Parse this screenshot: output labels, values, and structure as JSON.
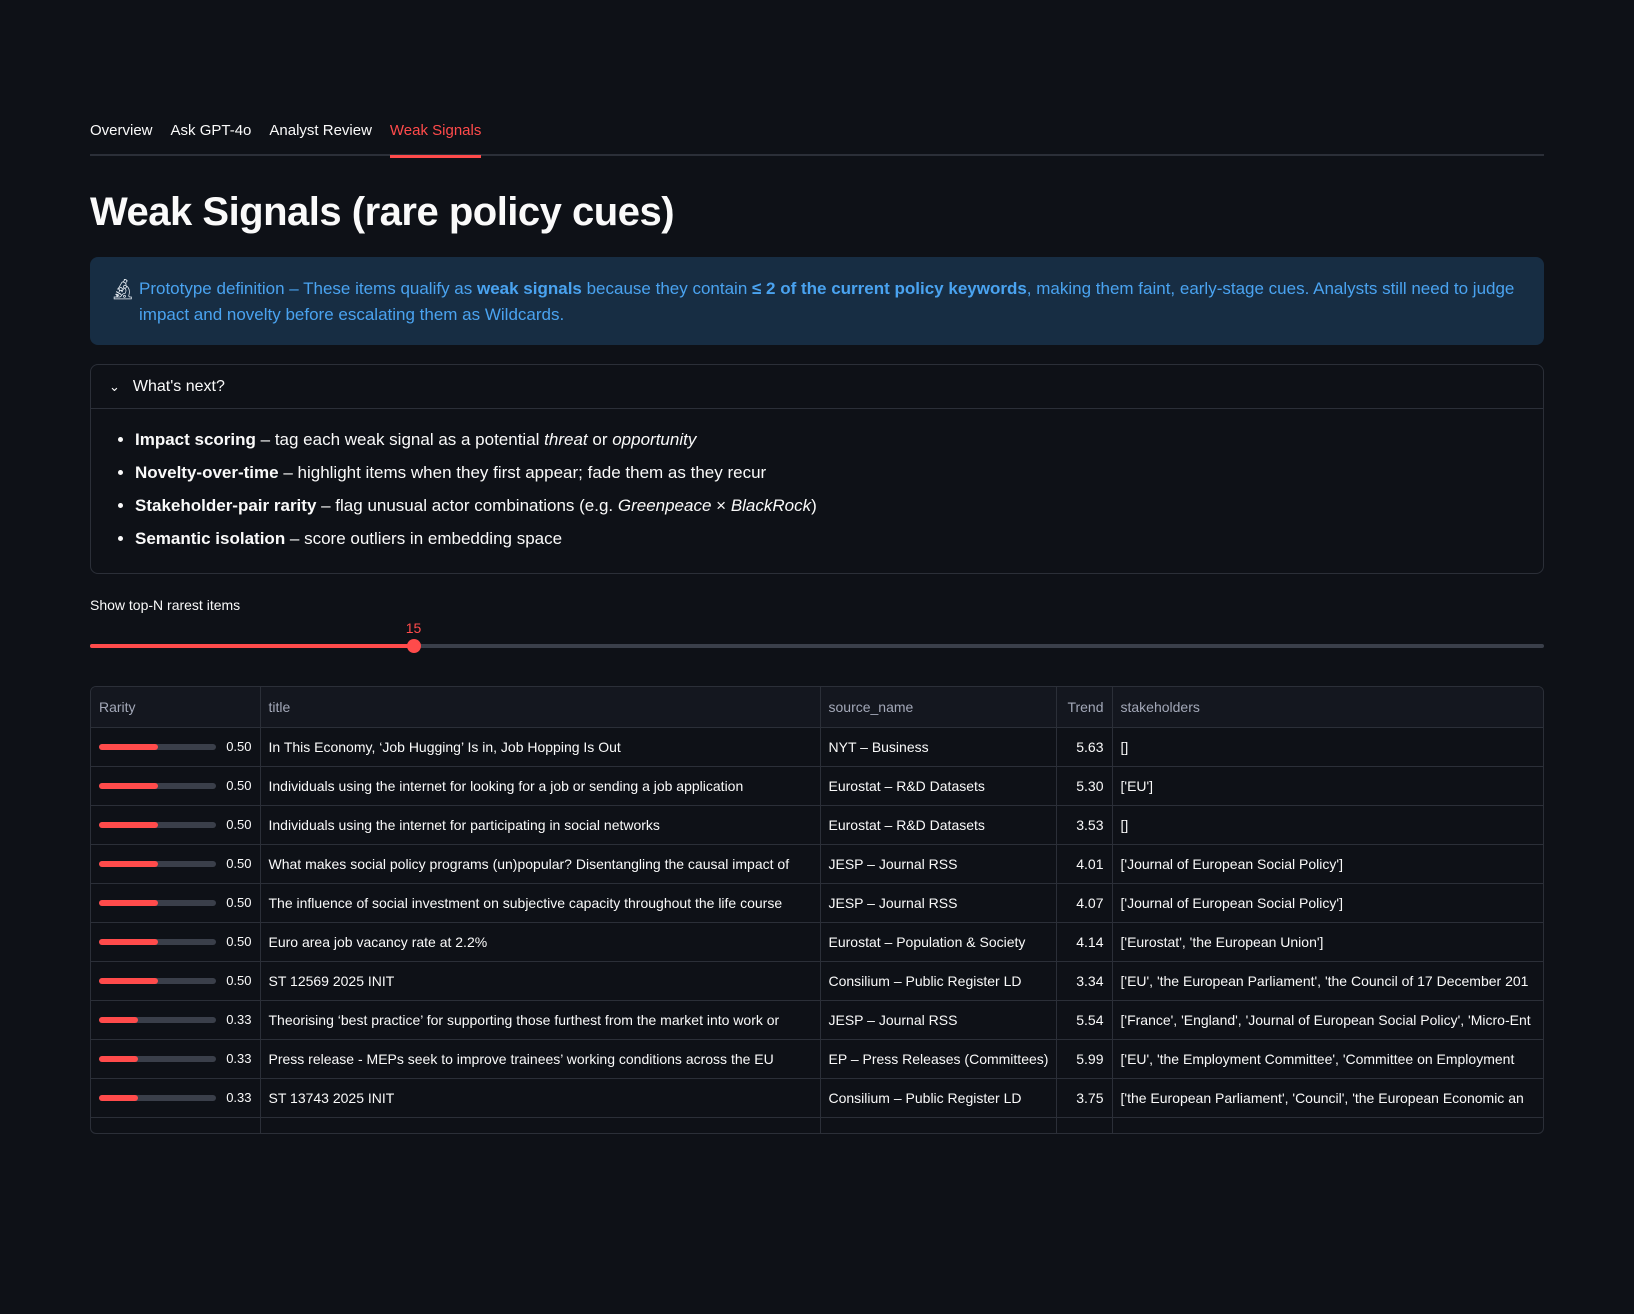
{
  "tabs": [
    {
      "label": "Overview",
      "active": false
    },
    {
      "label": "Ask GPT-4o",
      "active": false
    },
    {
      "label": "Analyst Review",
      "active": false
    },
    {
      "label": "Weak Signals",
      "active": true
    }
  ],
  "title": "Weak Signals (rare policy cues)",
  "info": {
    "icon": "microscope-icon",
    "t1": "Prototype definition – These items qualify as ",
    "b1": "weak signals",
    "t2": " because they contain ",
    "b2": "≤ 2 of the current policy keywords",
    "t3": ", making them faint, early-stage cues. Analysts still need to judge impact and novelty before escalating them as Wildcards."
  },
  "expander": {
    "label": "What's next?",
    "expanded": true,
    "items": [
      {
        "bold": "Impact scoring",
        "text": " – tag each weak signal as a potential ",
        "i1": "threat",
        "mid": " or ",
        "i2": "opportunity",
        "end": ""
      },
      {
        "bold": "Novelty-over-time",
        "text": " – highlight items when they first appear; fade them as they recur",
        "i1": "",
        "mid": "",
        "i2": "",
        "end": ""
      },
      {
        "bold": "Stakeholder-pair rarity",
        "text": " – flag unusual actor combinations (e.g. ",
        "i1": "Greenpeace",
        "mid": " × ",
        "i2": "BlackRock",
        "end": ")"
      },
      {
        "bold": "Semantic isolation",
        "text": " – score outliers in embedding space",
        "i1": "",
        "mid": "",
        "i2": "",
        "end": ""
      }
    ]
  },
  "slider": {
    "label": "Show top-N rarest items",
    "value": "15",
    "fraction": 0.2225
  },
  "table": {
    "columns": [
      "Rarity",
      "title",
      "source_name",
      "Trend",
      "stakeholders"
    ],
    "rows": [
      {
        "rarity": 0.5,
        "rarity_label": "0.50",
        "title": "In This Economy, ‘Job Hugging’ Is in, Job Hopping Is Out",
        "source": "NYT – Business",
        "trend": "5.63",
        "stakeholders": "[]"
      },
      {
        "rarity": 0.5,
        "rarity_label": "0.50",
        "title": "Individuals using the internet for looking for a job or sending a job application",
        "source": "Eurostat – R&D Datasets",
        "trend": "5.30",
        "stakeholders": "['EU']"
      },
      {
        "rarity": 0.5,
        "rarity_label": "0.50",
        "title": "Individuals using the internet for participating in social networks",
        "source": "Eurostat – R&D Datasets",
        "trend": "3.53",
        "stakeholders": "[]"
      },
      {
        "rarity": 0.5,
        "rarity_label": "0.50",
        "title": "What makes social policy programs (un)popular? Disentangling the causal impact of",
        "source": "JESP – Journal RSS",
        "trend": "4.01",
        "stakeholders": "['Journal of European Social Policy']"
      },
      {
        "rarity": 0.5,
        "rarity_label": "0.50",
        "title": "The influence of social investment on subjective capacity throughout the life course",
        "source": "JESP – Journal RSS",
        "trend": "4.07",
        "stakeholders": "['Journal of European Social Policy']"
      },
      {
        "rarity": 0.5,
        "rarity_label": "0.50",
        "title": "Euro area job vacancy rate at 2.2%",
        "source": "Eurostat – Population & Society",
        "trend": "4.14",
        "stakeholders": "['Eurostat', 'the European Union']"
      },
      {
        "rarity": 0.5,
        "rarity_label": "0.50",
        "title": "ST 12569 2025 INIT",
        "source": "Consilium – Public Register LD",
        "trend": "3.34",
        "stakeholders": "['EU', 'the European Parliament', 'the Council of 17 December 201"
      },
      {
        "rarity": 0.33,
        "rarity_label": "0.33",
        "title": "Theorising ‘best practice’ for supporting those furthest from the market into work or",
        "source": "JESP – Journal RSS",
        "trend": "5.54",
        "stakeholders": "['France', 'England', 'Journal of European Social Policy', 'Micro-Ent"
      },
      {
        "rarity": 0.33,
        "rarity_label": "0.33",
        "title": "Press release - MEPs seek to improve trainees’ working conditions across the EU",
        "source": "EP – Press Releases (Committees)",
        "trend": "5.99",
        "stakeholders": "['EU', 'the Employment Committee', 'Committee on Employment"
      },
      {
        "rarity": 0.33,
        "rarity_label": "0.33",
        "title": "ST 13743 2025 INIT",
        "source": "Consilium – Public Register LD",
        "trend": "3.75",
        "stakeholders": "['the European Parliament', 'Council', 'the European Economic an"
      }
    ]
  }
}
